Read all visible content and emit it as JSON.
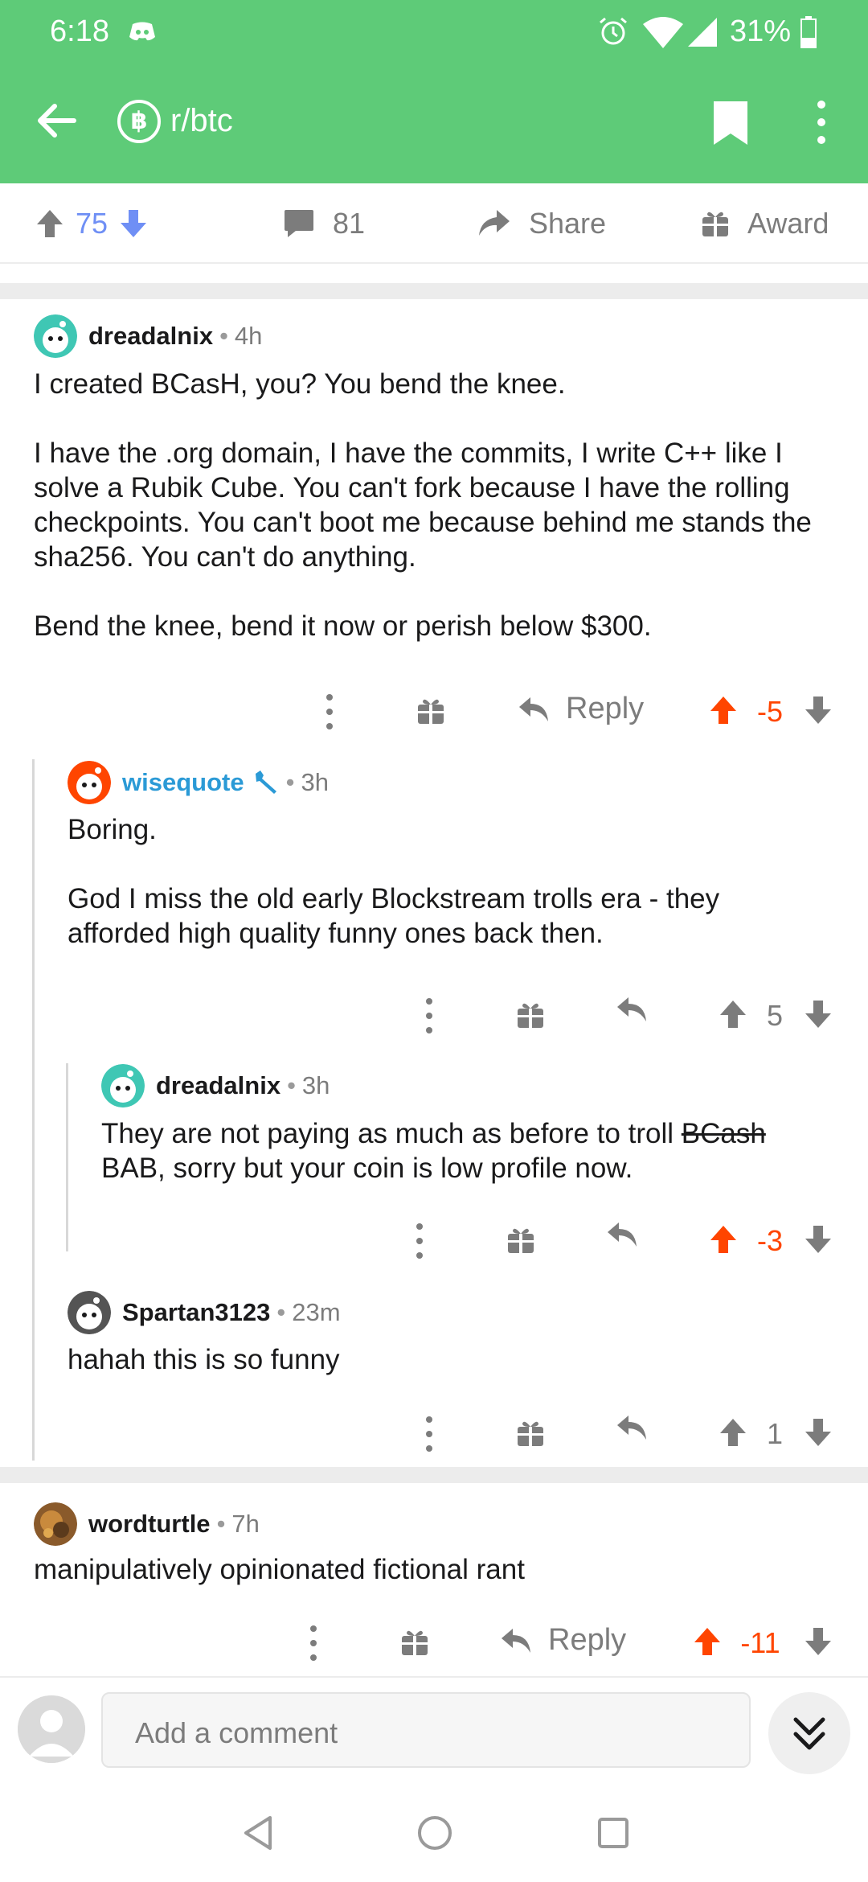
{
  "status_bar": {
    "time": "6:18",
    "battery": "31%"
  },
  "app_bar": {
    "subreddit_icon": "฿",
    "subreddit": "r/btc"
  },
  "post_bar": {
    "score": "75",
    "comments": "81",
    "share": "Share",
    "award": "Award"
  },
  "comments": [
    {
      "author": "dreadalnix",
      "age": "4h",
      "paragraphs": [
        "I created BCasH, you? You bend the knee.",
        "I have the .org domain, I have the commits, I write C++ like I solve a Rubik Cube. You can't fork because I have the rolling checkpoints. You can't boot me because behind me stands the sha256. You can't do anything.",
        "Bend the knee, bend it now or perish below $300."
      ],
      "reply_label": "Reply",
      "score": "-5"
    },
    {
      "author": "wisequote",
      "age": "3h",
      "paragraphs": [
        "Boring.",
        "God I miss the old early Blockstream trolls era - they afforded high quality funny ones back then."
      ],
      "score": "5"
    },
    {
      "author": "dreadalnix",
      "age": "3h",
      "body_start": "They are not paying as much as before to troll ",
      "body_strike": "BCash",
      "body_end": " BAB, sorry but your coin is low profile now.",
      "score": "-3"
    },
    {
      "author": "Spartan3123",
      "age": "23m",
      "paragraphs": [
        "hahah this is so funny"
      ],
      "score": "1"
    },
    {
      "author": "wordturtle",
      "age": "7h",
      "paragraphs": [
        "manipulatively opinionated fictional rant"
      ],
      "reply_label": "Reply",
      "score": "-11"
    }
  ],
  "comment_bar": {
    "placeholder": "Add a comment"
  },
  "colors": {
    "brand_green": "#5ecb78",
    "upvoted": "#ff4500",
    "post_upvote": "#6f8ff5",
    "mod": "#2b9ad6"
  },
  "icons": [
    "back-arrow-icon",
    "bitcoin-icon",
    "bookmark-icon",
    "more-vert-icon",
    "upvote-icon",
    "downvote-icon",
    "comment-icon",
    "share-icon",
    "gift-icon",
    "reply-icon",
    "wrench-icon",
    "chevrons-down-icon"
  ]
}
